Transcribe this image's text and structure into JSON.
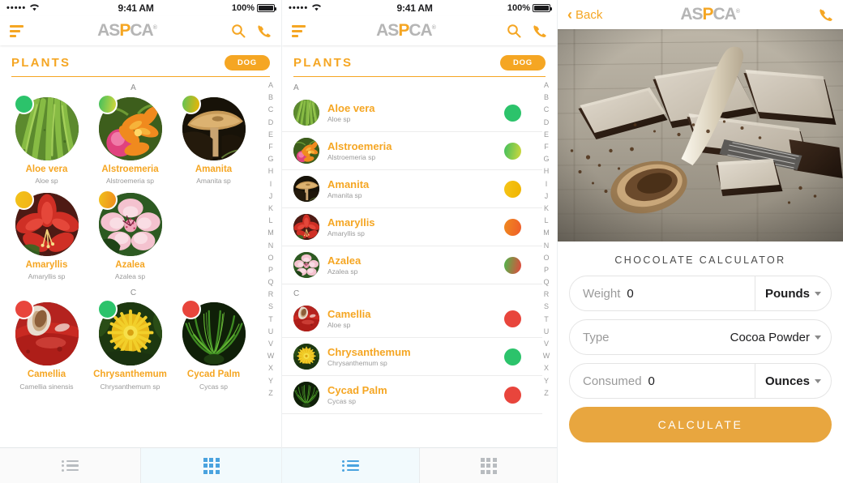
{
  "status_bar": {
    "signal_dots": "•••••",
    "time": "9:41 AM",
    "battery_label": "100%"
  },
  "brand": {
    "logo_a1": "AS",
    "logo_p": "P",
    "logo_rest": "CA",
    "registered": "®"
  },
  "nav": {
    "menu_icon": "hamburger-filter-icon",
    "search_icon": "search-icon",
    "phone_icon": "phone-icon"
  },
  "section": {
    "title": "PLANTS",
    "pill": "DOG",
    "accent": "#f5a623"
  },
  "alpha_index": [
    "A",
    "B",
    "C",
    "D",
    "E",
    "F",
    "G",
    "H",
    "I",
    "J",
    "K",
    "L",
    "M",
    "N",
    "O",
    "P",
    "Q",
    "R",
    "S",
    "T",
    "U",
    "V",
    "W",
    "X",
    "Y",
    "Z"
  ],
  "grid_panel": {
    "sections": [
      {
        "letter": "A",
        "rows": [
          [
            {
              "name": "Aloe vera",
              "sub": "Aloe sp",
              "badge": "#2cc36b",
              "badge2": "#2cc36b",
              "img": "aloe"
            },
            {
              "name": "Alstroemeria",
              "sub": "Alstroemeria sp",
              "badge": "#3fbf5e",
              "badge2": "#d8d83a",
              "img": "alstroemeria"
            },
            {
              "name": "Amanita",
              "sub": "Amanita sp",
              "badge": "#5cc45a",
              "badge2": "#f0b400",
              "img": "amanita"
            }
          ],
          [
            {
              "name": "Amaryllis",
              "sub": "Amaryllis sp",
              "badge": "#f2c21a",
              "badge2": "#f2b418",
              "img": "amaryllis"
            },
            {
              "name": "Azalea",
              "sub": "Azalea sp",
              "badge": "#f0c21c",
              "badge2": "#ef8a1e",
              "img": "azalea"
            }
          ]
        ]
      },
      {
        "letter": "C",
        "rows": [
          [
            {
              "name": "Camellia",
              "sub": "Camellia sinensis",
              "badge": "#e8453c",
              "badge2": "#e8453c",
              "img": "camellia"
            },
            {
              "name": "Chrysanthemum",
              "sub": "Chrysanthemum sp",
              "badge": "#2cc36b",
              "badge2": "#2cc36b",
              "img": "chrysanthemum"
            },
            {
              "name": "Cycad Palm",
              "sub": "Cycas sp",
              "badge": "#e8453c",
              "badge2": "#e8453c",
              "img": "cycad"
            }
          ]
        ]
      }
    ]
  },
  "list_panel": {
    "sections": [
      {
        "letter": "A",
        "items": [
          {
            "name": "Aloe vera",
            "sub": "Aloe sp",
            "dot1": "#2cc36b",
            "dot2": "#2cc36b",
            "img": "aloe"
          },
          {
            "name": "Alstroemeria",
            "sub": "Alstroemeria sp",
            "dot1": "#3fbf5e",
            "dot2": "#d4d83a",
            "img": "alstroemeria"
          },
          {
            "name": "Amanita",
            "sub": "Amanita sp",
            "dot1": "#f5c518",
            "dot2": "#f0b400",
            "img": "amanita"
          },
          {
            "name": "Amaryllis",
            "sub": "Amaryllis sp",
            "dot1": "#ef8a1e",
            "dot2": "#ef5c2a",
            "img": "amaryllis"
          },
          {
            "name": "Azalea",
            "sub": "Azalea sp",
            "dot1": "#4cb94c",
            "dot2": "#e8453c",
            "img": "azalea"
          }
        ]
      },
      {
        "letter": "C",
        "items": [
          {
            "name": "Camellia",
            "sub": "Aloe sp",
            "dot1": "#e8453c",
            "dot2": "#e8453c",
            "img": "camellia"
          },
          {
            "name": "Chrysanthemum",
            "sub": "Chrysanthemum sp",
            "dot1": "#2cc36b",
            "dot2": "#2cc36b",
            "img": "chrysanthemum"
          },
          {
            "name": "Cycad Palm",
            "sub": "Cycas sp",
            "dot1": "#e8453c",
            "dot2": "#e8453c",
            "img": "cycad"
          }
        ]
      }
    ]
  },
  "tabbar": {
    "list_icon": "list-view-icon",
    "grid_icon": "grid-view-icon",
    "active_color": "#4aa3df",
    "inactive_color": "#b8bcc0",
    "grid_panel_active": "grid",
    "list_panel_active": "list"
  },
  "calculator": {
    "back_label": "Back",
    "phone_icon": "phone-icon",
    "hero_image": "chocolate-bars-cocoa-spoon-photo",
    "title": "CHOCOLATE CALCULATOR",
    "fields": [
      {
        "label": "Weight",
        "value": "0",
        "unit": "Pounds",
        "unit_bold": true,
        "value_right": false
      },
      {
        "label": "Type",
        "value": "",
        "unit": "Cocoa Powder",
        "unit_bold": false,
        "value_right": false
      },
      {
        "label": "Consumed",
        "value": "0",
        "unit": "Ounces",
        "unit_bold": true,
        "value_right": false
      }
    ],
    "cta": "CALCULATE",
    "cta_color": "#e8a63f"
  }
}
